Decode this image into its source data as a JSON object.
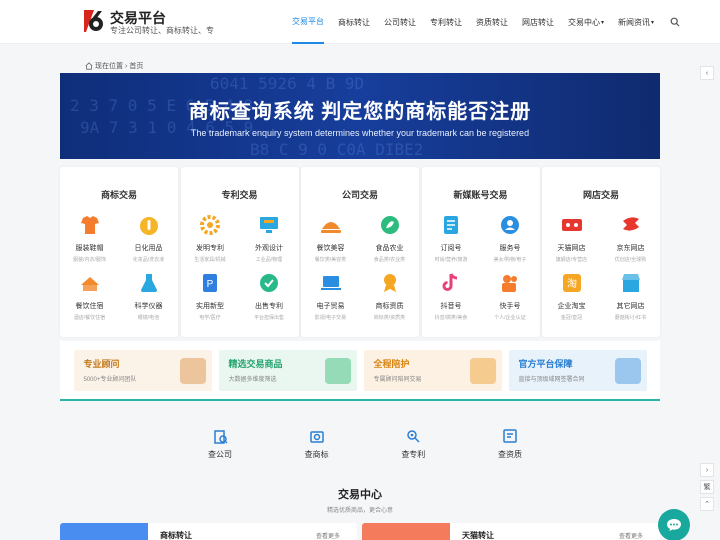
{
  "header": {
    "brand": "交易平台",
    "slogan": "专注公司转让、商标转让、专",
    "nav": [
      {
        "label": "交易平台",
        "active": true,
        "dropdown": false
      },
      {
        "label": "商标转让",
        "active": false,
        "dropdown": false
      },
      {
        "label": "公司转让",
        "active": false,
        "dropdown": false
      },
      {
        "label": "专利转让",
        "active": false,
        "dropdown": false
      },
      {
        "label": "资质转让",
        "active": false,
        "dropdown": false
      },
      {
        "label": "网店转让",
        "active": false,
        "dropdown": false
      },
      {
        "label": "交易中心",
        "active": false,
        "dropdown": true
      },
      {
        "label": "新闻资讯",
        "active": false,
        "dropdown": true
      }
    ],
    "accent_color": "#1e88e5"
  },
  "breadcrumb": {
    "label": "现在位置",
    "sep": "›",
    "current": "首页"
  },
  "banner": {
    "title": "商标查询系统 判定您的商标能否注册",
    "subtitle": "The trademark enquiry system determines whether your trademark can be registered",
    "bg_color": "#173e9c"
  },
  "categories": [
    {
      "title": "商标交易",
      "items": [
        {
          "label": "服装鞋帽",
          "sub": "服装/内衣/服饰",
          "icon": "shirt-icon",
          "color": "#f47c2c"
        },
        {
          "label": "日化用品",
          "sub": "化妆品/洗衣液",
          "icon": "bottle-icon",
          "color": "#f5b526"
        },
        {
          "label": "餐饮住宿",
          "sub": "酒店/餐饮住宿",
          "icon": "hotel-icon",
          "color": "#f28a2d"
        },
        {
          "label": "科学仪器",
          "sub": "眼镜/电池",
          "icon": "flask-icon",
          "color": "#2aa7e0"
        }
      ]
    },
    {
      "title": "专利交易",
      "items": [
        {
          "label": "发明专利",
          "sub": "生活家具/机械",
          "icon": "gear-icon",
          "color": "#f5a623"
        },
        {
          "label": "外观设计",
          "sub": "工业品/物理",
          "icon": "monitor-icon",
          "color": "#2aa7e0"
        },
        {
          "label": "实用新型",
          "sub": "电学/医疗",
          "icon": "patent-icon",
          "color": "#2f7fe0"
        },
        {
          "label": "出售专利",
          "sub": "平台担保出售",
          "icon": "sale-icon",
          "color": "#28b98a"
        }
      ]
    },
    {
      "title": "公司交易",
      "items": [
        {
          "label": "餐饮美容",
          "sub": "餐饮类/美容类",
          "icon": "food-cover-icon",
          "color": "#f28a2d"
        },
        {
          "label": "食品农业",
          "sub": "食品类/农业类",
          "icon": "leaf-icon",
          "color": "#2dbb7e"
        },
        {
          "label": "电子贸易",
          "sub": "影视/电子交易",
          "icon": "laptop-icon",
          "color": "#2a8fe0"
        },
        {
          "label": "商标资质",
          "sub": "商标类/资质类",
          "icon": "badge-icon",
          "color": "#f5a623"
        }
      ]
    },
    {
      "title": "新媒账号交易",
      "items": [
        {
          "label": "订阅号",
          "sub": "时尚/营养/旅游",
          "icon": "document-icon",
          "color": "#2aa7e0"
        },
        {
          "label": "服务号",
          "sub": "美女/购物/电子",
          "icon": "user-service-icon",
          "color": "#2a8fe0"
        },
        {
          "label": "抖音号",
          "sub": "抖音/搞笑/美食",
          "icon": "tiktok-icon",
          "color": "#e8417a"
        },
        {
          "label": "快手号",
          "sub": "个人/企业认证",
          "icon": "video-camera-icon",
          "color": "#f47c2c"
        }
      ]
    },
    {
      "title": "网店交易",
      "items": [
        {
          "label": "天猫网店",
          "sub": "旗舰店/专营店",
          "icon": "tmall-icon",
          "color": "#e8372e"
        },
        {
          "label": "京东网店",
          "sub": "优创店/全球购",
          "icon": "jd-icon",
          "color": "#e8372e"
        },
        {
          "label": "企业淘宝",
          "sub": "金冠/皇冠",
          "icon": "taobao-icon",
          "color": "#f5a623"
        },
        {
          "label": "其它网店",
          "sub": "蘑菇街/小红书",
          "icon": "shop-icon",
          "color": "#2aa7e0"
        }
      ]
    }
  ],
  "features": [
    {
      "title": "专业顾问",
      "desc": "5000+专业顾问团队",
      "bg": "#fbf2e8",
      "color": "#c47a1c",
      "ill": "#e8b98a"
    },
    {
      "title": "精选交易商品",
      "desc": "大数据多维度筛选",
      "bg": "#eaf7f1",
      "color": "#24a36d",
      "ill": "#7fd3aa"
    },
    {
      "title": "全程陪护",
      "desc": "专属顾问陪同交易",
      "bg": "#fcf1e2",
      "color": "#d98513",
      "ill": "#f2c27a"
    },
    {
      "title": "官方平台保障",
      "desc": "直接与顶级域网签署合同",
      "bg": "#e8f2fb",
      "color": "#2b7fd1",
      "ill": "#87bbeb"
    }
  ],
  "quick_links": [
    {
      "label": "查公司",
      "icon": "company-search-icon"
    },
    {
      "label": "查商标",
      "icon": "trademark-search-icon"
    },
    {
      "label": "查专利",
      "icon": "patent-search-icon"
    },
    {
      "label": "查资质",
      "icon": "qualification-search-icon"
    }
  ],
  "center": {
    "title": "交易中心",
    "subtitle": "精选优质商品，更合心意"
  },
  "bottom_cards": [
    {
      "label": "商标转让",
      "more": "查看更多",
      "tab_color": "#4a8df0"
    },
    {
      "label": "天猫转让",
      "more": "查看更多",
      "tab_color": "#f47c5c"
    }
  ],
  "side_tools": [
    "‹",
    "›",
    "繁",
    "⌃"
  ],
  "theme": {
    "teal": "#18a89e"
  }
}
